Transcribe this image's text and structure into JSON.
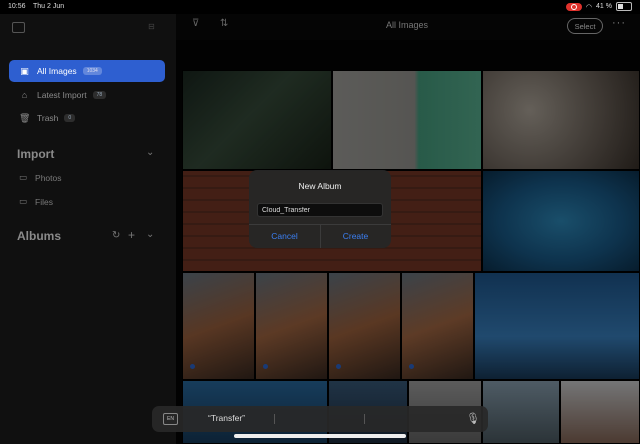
{
  "status": {
    "time": "10:56",
    "date": "Thu 2 Jun",
    "battery": "41 %"
  },
  "sidebar": {
    "items": [
      {
        "label": "All Images",
        "badge": "1034",
        "icon": "photo-stack-icon",
        "active": true
      },
      {
        "label": "Latest Import",
        "badge": "78",
        "icon": "import-icon",
        "active": false
      },
      {
        "label": "Trash",
        "badge": "0",
        "icon": "trash-icon",
        "active": false
      }
    ],
    "import_section": {
      "label": "Import",
      "items": [
        {
          "label": "Photos",
          "icon": "photos-icon"
        },
        {
          "label": "Files",
          "icon": "folder-icon"
        }
      ]
    },
    "albums_section": {
      "label": "Albums"
    }
  },
  "header": {
    "title": "All Images",
    "select_label": "Select",
    "more_label": "···"
  },
  "dialog": {
    "title": "New Album",
    "input_value": "Cloud_Transfer",
    "cancel_label": "Cancel",
    "create_label": "Create"
  },
  "keyboard": {
    "lang": "EN",
    "suggestion": "“Transfer”"
  },
  "colors": {
    "accent": "#2e5fd0",
    "dialog_button": "#3b7ff2"
  }
}
